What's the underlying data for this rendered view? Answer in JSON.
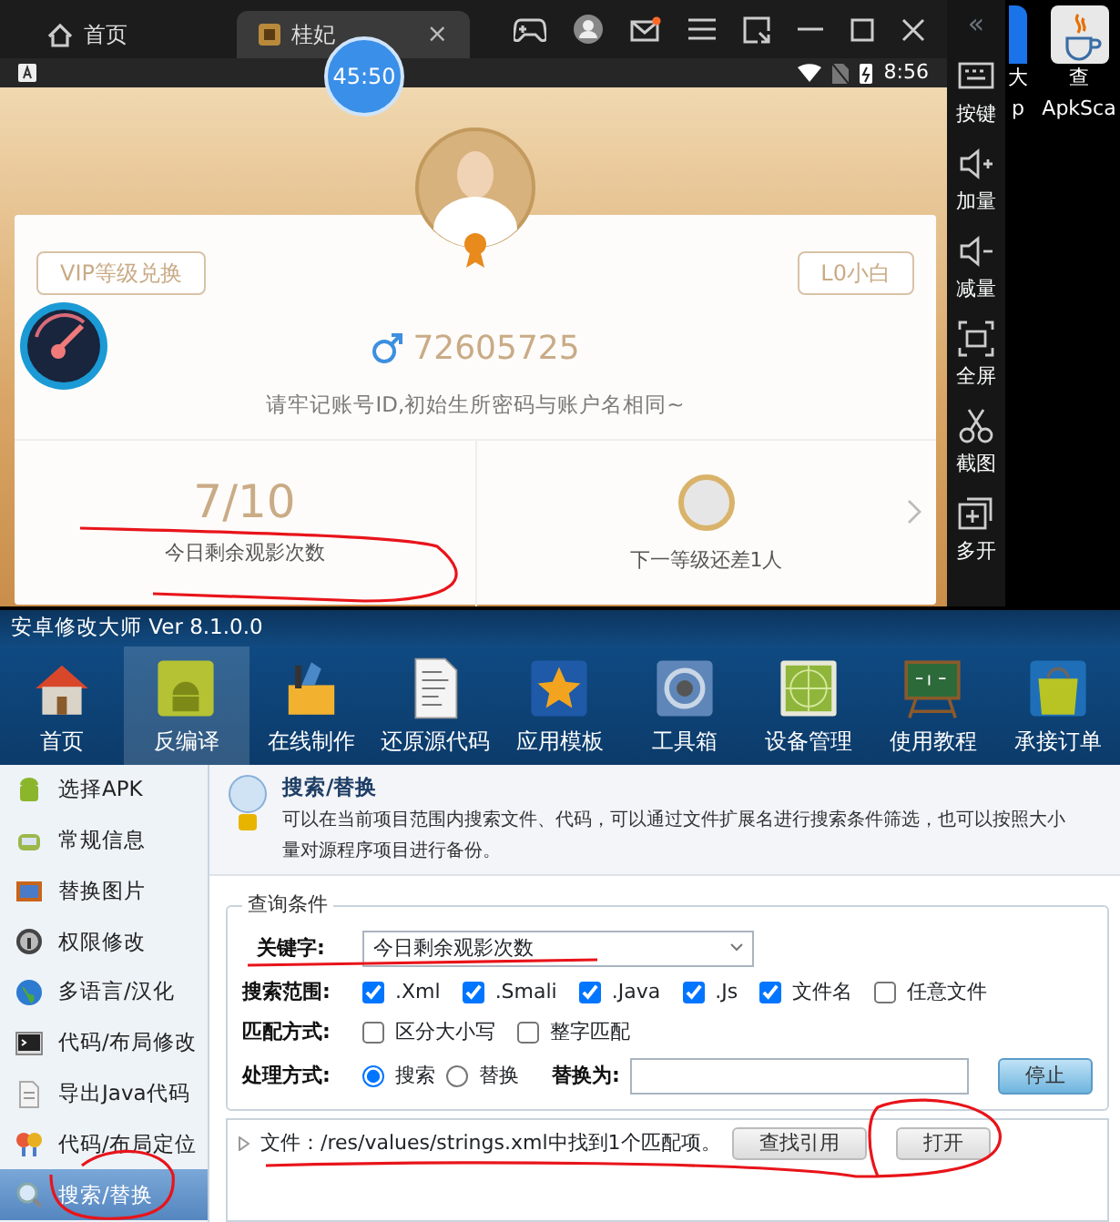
{
  "emulator": {
    "tabs": [
      {
        "label": "首页",
        "selected": false
      },
      {
        "label": "桂妃",
        "selected": true
      }
    ],
    "close_tab": "×",
    "timer": "45:50",
    "clock": "8:56"
  },
  "profile": {
    "vip_button": "VIP等级兑换",
    "level_button": "L0小白",
    "user_id": "72605725",
    "notice": "请牢记账号ID,初始生所密码与账户名相同~",
    "stats": [
      {
        "value": "7/10",
        "label": "今日剩余观影次数"
      },
      {
        "label": "下一等级还差1人"
      }
    ]
  },
  "side_toolbar": {
    "collapse": "«",
    "items": [
      "按键",
      "加量",
      "减量",
      "全屏",
      "截图",
      "多开"
    ]
  },
  "desktop_icons": [
    {
      "lines": [
        "大",
        "p"
      ]
    },
    {
      "lines": [
        "查",
        "ApkSca"
      ]
    }
  ],
  "tool_window": {
    "title": "安卓修改大师 Ver 8.1.0.0",
    "toolbar": [
      {
        "label": "首页",
        "selected": false
      },
      {
        "label": "反编译",
        "selected": true
      },
      {
        "label": "在线制作",
        "selected": false
      },
      {
        "label": "还原源代码",
        "selected": false
      },
      {
        "label": "应用模板",
        "selected": false
      },
      {
        "label": "工具箱",
        "selected": false
      },
      {
        "label": "设备管理",
        "selected": false
      },
      {
        "label": "使用教程",
        "selected": false
      },
      {
        "label": "承接订单",
        "selected": false
      }
    ],
    "sidebar": [
      {
        "label": "选择APK",
        "selected": false
      },
      {
        "label": "常规信息",
        "selected": false
      },
      {
        "label": "替换图片",
        "selected": false
      },
      {
        "label": "权限修改",
        "selected": false
      },
      {
        "label": "多语言/汉化",
        "selected": false
      },
      {
        "label": "代码/布局修改",
        "selected": false
      },
      {
        "label": "导出Java代码",
        "selected": false
      },
      {
        "label": "代码/布局定位",
        "selected": false
      },
      {
        "label": "搜索/替换",
        "selected": true
      }
    ],
    "panel": {
      "heading": "搜索/替换",
      "description": [
        "可以在当前项目范围内搜索文件、代码，可以通过文件扩展名进行搜索条件筛选，也可以按照大小",
        "量对源程序项目进行备份。"
      ],
      "group_title": "查询条件",
      "keyword_label": "关键字:",
      "keyword": "今日剩余观影次数",
      "scope_label": "搜索范围:",
      "scope": [
        {
          "label": ".Xml",
          "checked": true
        },
        {
          "label": ".Smali",
          "checked": true
        },
        {
          "label": ".Java",
          "checked": true
        },
        {
          "label": ".Js",
          "checked": true
        },
        {
          "label": "文件名",
          "checked": true
        },
        {
          "label": "任意文件",
          "checked": false
        }
      ],
      "match_label": "匹配方式:",
      "match": [
        {
          "label": "区分大小写",
          "checked": false
        },
        {
          "label": "整字匹配",
          "checked": false
        }
      ],
      "mode_label": "处理方式:",
      "modes": [
        {
          "label": "搜索",
          "selected": true
        },
        {
          "label": "替换",
          "selected": false
        }
      ],
      "replace_label": "替换为:",
      "stop_button": "停止",
      "results": [
        {
          "text": "文件：/res/values/strings.xml中找到1个匹配项。",
          "buttons": [
            "查找引用",
            "打开"
          ]
        }
      ]
    }
  }
}
